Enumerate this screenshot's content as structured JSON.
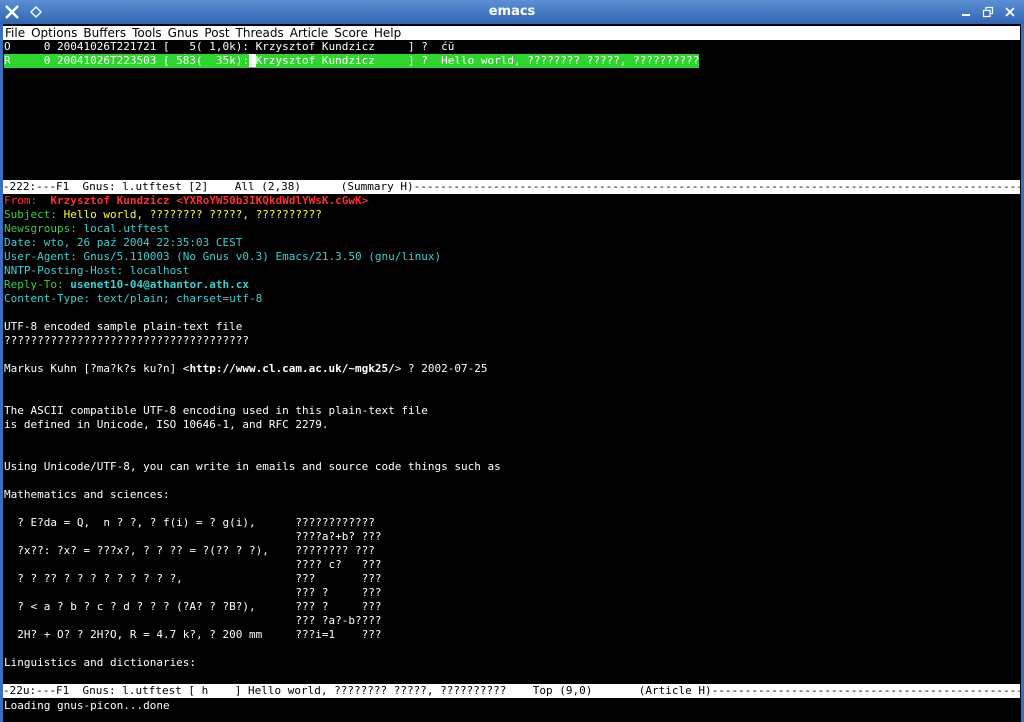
{
  "window": {
    "title": "emacs"
  },
  "menubar": [
    "File",
    "Options",
    "Buffers",
    "Tools",
    "Gnus",
    "Post",
    "Threads",
    "Article",
    "Score",
    "Help"
  ],
  "summary": {
    "rows": [
      {
        "mark": "O",
        "text": "O     0 20041026T221721 [   5( 1,0k): Krzysztof Kundzicz     ] ?  ćŭ"
      },
      {
        "mark": "R",
        "prefix": "R     0 20041026T223503 [ 583(  35k):",
        "cursor": " ",
        "rest": "Krzysztof Kundzicz     ] ?  Hello world, ???????? ?????, ??????????"
      }
    ],
    "modeline": "-222:---F1  Gnus: l.utftest [2]    All (2,38)      (Summary H)---------------------------------------------------------------------------------------------------------------------------"
  },
  "article": {
    "headers": {
      "from_label": "From:",
      "from_value": "  Krzysztof Kundzicz <YXRoYW50b3IKQkdWdlYWsK.cGwK>",
      "subject_label": "Subject:",
      "subject_value": " Hello world, ???????? ?????, ??????????",
      "newsgroups_label": "Newsgroups:",
      "newsgroups_value": " local.utftest",
      "date": "Date: wto, 26 paź 2004 22:35:03 CEST",
      "user_agent": "User-Agent: Gnus/5.110003 (No Gnus v0.3) Emacs/21.3.50 (gnu/linux)",
      "nntp": "NNTP-Posting-Host: localhost",
      "reply_to_label": "Reply-To:",
      "reply_to_value": " usenet10-04@athantor.ath.cx",
      "content_type": "Content-Type: text/plain; charset=utf-8"
    },
    "body": {
      "l1": "UTF-8 encoded sample plain-text file",
      "l2": "?????????????????????????????????????",
      "markus_pre": "Markus Kuhn [?ma?k?s ku?n] <",
      "markus_url": "http://www.cl.cam.ac.uk/~mgk25/",
      "markus_post": "> ? 2002-07-25",
      "p1a": "The ASCII compatible UTF-8 encoding used in this plain-text file",
      "p1b": "is defined in Unicode, ISO 10646-1, and RFC 2279.",
      "p2": "Using Unicode/UTF-8, you can write in emails and source code things such as",
      "math_title": "Mathematics and sciences:",
      "m1": "  ? E?da = Q,  n ? ?, ? f(i) = ? g(i),      ????????????",
      "m2": "                                            ????a?+b? ???",
      "m3": "  ?x??: ?x? = ???x?, ? ? ?? = ?(?? ? ?),    ???????? ???",
      "m4": "                                            ???? c?   ???",
      "m5": "  ? ? ?? ? ? ? ? ? ? ? ? ?,                 ???       ???",
      "m6": "                                            ??? ?     ???",
      "m7": "  ? < a ? b ? c ? d ? ? ? (?A? ? ?B?),      ??? ?     ???",
      "m8": "                                            ??? ?a?-b????",
      "m9": "  2H? + O? ? 2H?O, R = 4.7 k?, ? 200 mm     ???i=1    ???",
      "ling_title": "Linguistics and dictionaries:"
    },
    "modeline": "-22u:---F1  Gnus: l.utftest [ h    ] Hello world, ???????? ?????, ??????????    Top (9,0)       (Article H)------------------------------------------------------------------------------------------------"
  },
  "echo_area": "Loading gnus-picon...done"
}
